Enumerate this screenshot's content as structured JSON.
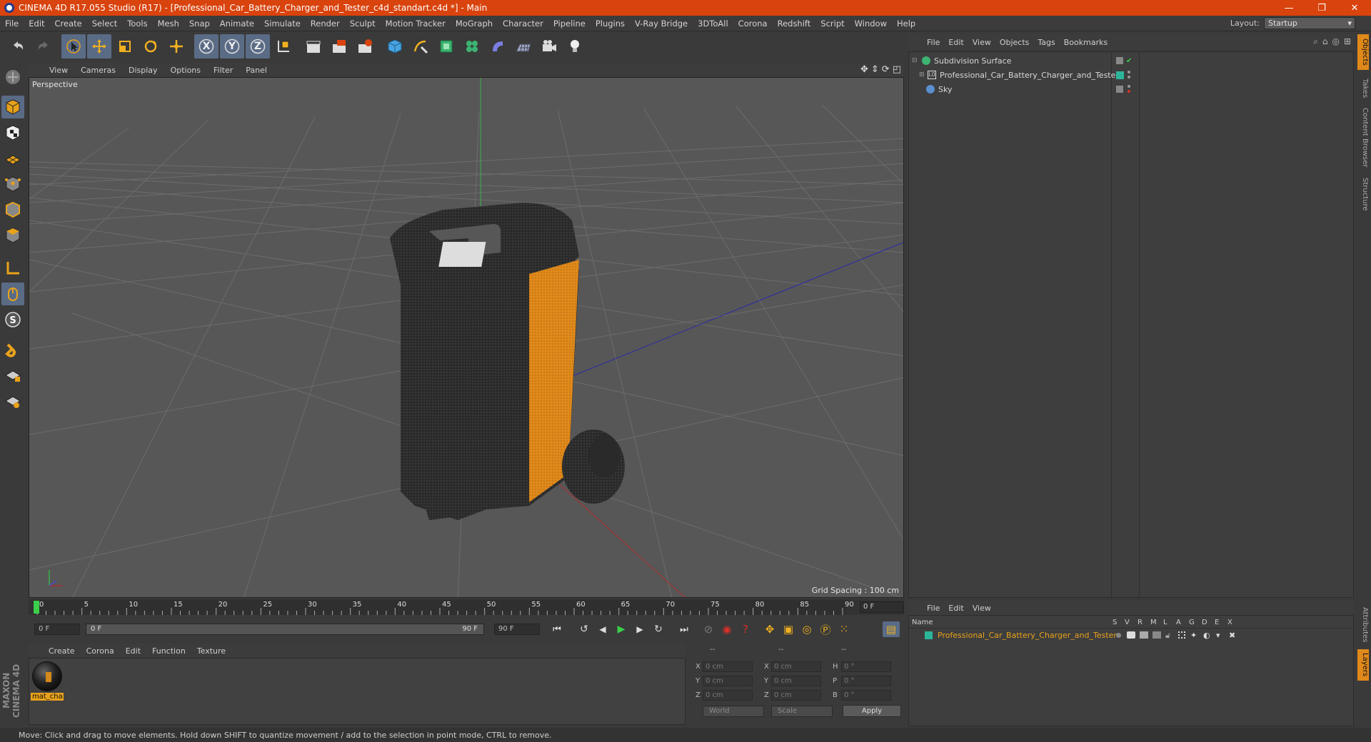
{
  "titlebar": {
    "title": "CINEMA 4D R17.055 Studio (R17) - [Professional_Car_Battery_Charger_and_Tester_c4d_standart.c4d *] - Main",
    "minimize": "—",
    "restore": "❐",
    "close": "✕"
  },
  "menu": [
    "File",
    "Edit",
    "Create",
    "Select",
    "Tools",
    "Mesh",
    "Snap",
    "Animate",
    "Simulate",
    "Render",
    "Sculpt",
    "Motion Tracker",
    "MoGraph",
    "Character",
    "Pipeline",
    "Plugins",
    "V-Ray Bridge",
    "3DToAll",
    "Corona",
    "Redshift",
    "Script",
    "Window",
    "Help"
  ],
  "layout": {
    "label": "Layout:",
    "value": "Startup"
  },
  "toolbar": {
    "x_label": "X",
    "y_label": "Y",
    "z_label": "Z"
  },
  "viewport": {
    "menu": [
      "View",
      "Cameras",
      "Display",
      "Options",
      "Filter",
      "Panel"
    ],
    "label": "Perspective",
    "grid_spacing": "Grid Spacing : 100 cm"
  },
  "timeline": {
    "ticks": [
      "0",
      "5",
      "10",
      "15",
      "20",
      "25",
      "30",
      "35",
      "40",
      "45",
      "50",
      "55",
      "60",
      "65",
      "70",
      "75",
      "80",
      "85",
      "90"
    ],
    "current_frame": "0 F"
  },
  "transport": {
    "start_field": "0 F",
    "range_start": "0 F",
    "range_end": "90 F",
    "end_field": "90 F"
  },
  "material_manager": {
    "menu": [
      "Create",
      "Corona",
      "Edit",
      "Function",
      "Texture"
    ],
    "material_name": "mat_cha"
  },
  "coordinates": {
    "header": [
      "--",
      "--",
      "--"
    ],
    "rows": [
      {
        "a": "X",
        "av": "0 cm",
        "b": "X",
        "bv": "0 cm",
        "c": "H",
        "cv": "0 °"
      },
      {
        "a": "Y",
        "av": "0 cm",
        "b": "Y",
        "bv": "0 cm",
        "c": "P",
        "cv": "0 °"
      },
      {
        "a": "Z",
        "av": "0 cm",
        "b": "Z",
        "bv": "0 cm",
        "c": "B",
        "cv": "0 °"
      }
    ],
    "space": "World",
    "mode": "Scale",
    "apply": "Apply"
  },
  "object_manager": {
    "menu": [
      "File",
      "Edit",
      "View",
      "Objects",
      "Tags",
      "Bookmarks"
    ],
    "objects": [
      {
        "name": "Subdivision Surface"
      },
      {
        "name": "Professional_Car_Battery_Charger_and_Tester"
      },
      {
        "name": "Sky"
      }
    ]
  },
  "right_tabs": [
    "Objects",
    "Takes",
    "Content Browser",
    "Structure",
    "Attributes",
    "Layers"
  ],
  "layer_manager": {
    "menu": [
      "File",
      "Edit",
      "View"
    ],
    "columns": [
      "Name",
      "S",
      "V",
      "R",
      "M",
      "L",
      "A",
      "G",
      "D",
      "E",
      "X"
    ],
    "layer_name": "Professional_Car_Battery_Charger_and_Tester"
  },
  "status": "Move: Click and drag to move elements. Hold down SHIFT to quantize movement / add to the selection in point mode, CTRL to remove.",
  "logo": "MAXON CINEMA 4D",
  "colors": {
    "titlebar": "#d9430d",
    "accent_orange": "#e0891a",
    "layer_green": "#2bb59a",
    "active_tool": "#5a6b86"
  }
}
